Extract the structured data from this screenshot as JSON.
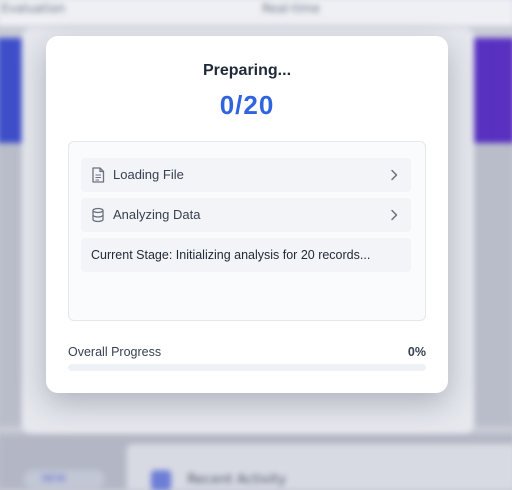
{
  "background": {
    "topbar_left": "Evaluation",
    "topbar_right": "Real-time",
    "bottom_pill": "NEW",
    "bottom_card_label": "Recent Activity"
  },
  "modal": {
    "title": "Preparing...",
    "counter": "0/20",
    "stages": [
      {
        "label": "Loading File",
        "icon": "file-icon"
      },
      {
        "label": "Analyzing Data",
        "icon": "database-icon"
      }
    ],
    "current_stage": "Current Stage: Initializing analysis for 20 records...",
    "overall_label": "Overall Progress",
    "overall_percent_text": "0%",
    "overall_progress": 0,
    "accent_color": "#2f63e0"
  }
}
